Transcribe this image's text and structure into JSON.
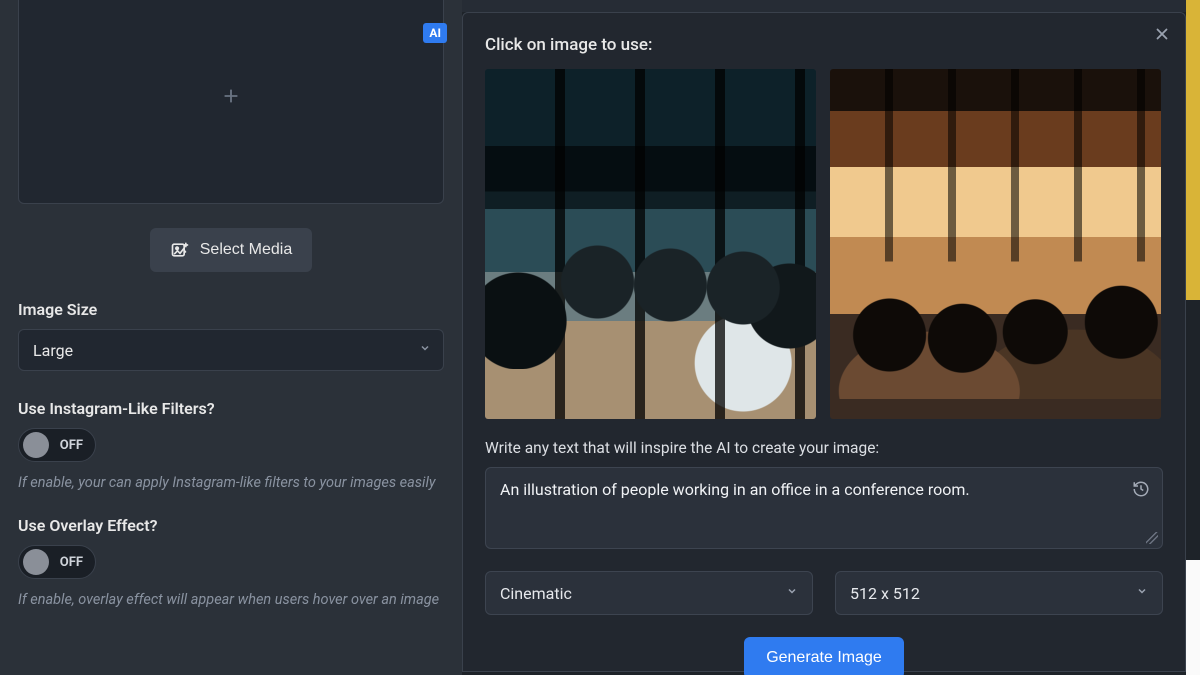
{
  "sidebar": {
    "ai_badge": "AI",
    "select_media_label": "Select Media",
    "image_size": {
      "label": "Image Size",
      "value": "Large"
    },
    "filters": {
      "label": "Use Instagram-Like Filters?",
      "state": "OFF",
      "hint": "If enable, your can apply Instagram-like filters to your images easily"
    },
    "overlay": {
      "label": "Use Overlay Effect?",
      "state": "OFF",
      "hint": "If enable, overlay effect will appear when users hover over an image"
    }
  },
  "modal": {
    "title": "Click on image to use:",
    "prompt_label": "Write any text that will inspire the AI to create your image:",
    "prompt_value": "An illustration of people working in an office in a conference room.",
    "style_select": "Cinematic",
    "size_select": "512 x 512",
    "generate_label": "Generate Image"
  }
}
